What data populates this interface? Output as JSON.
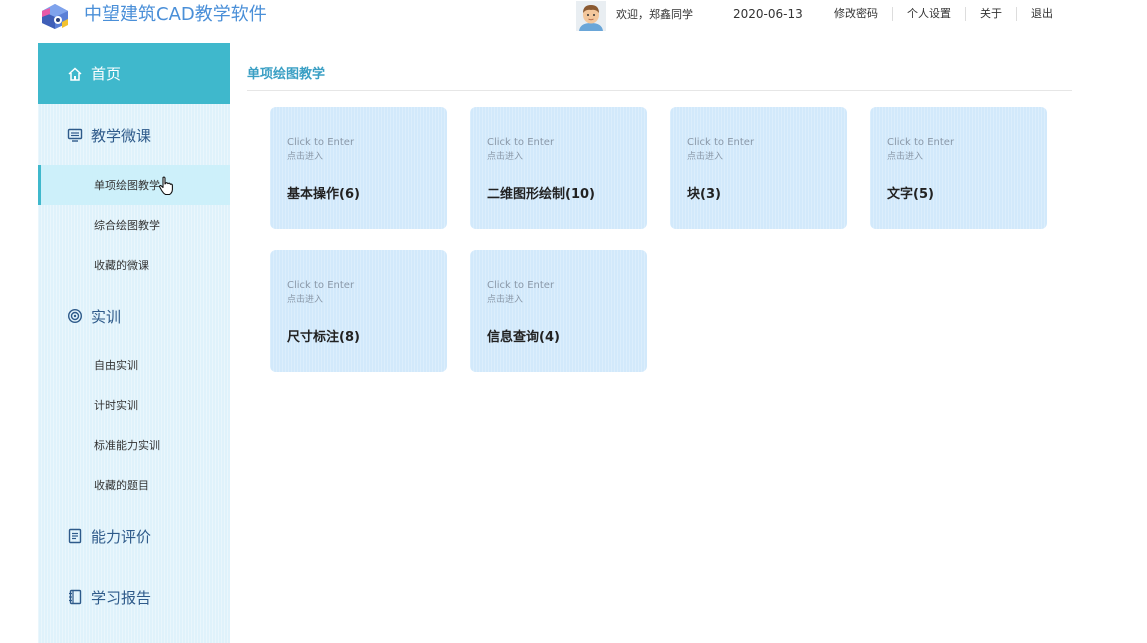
{
  "app": {
    "title": "中望建筑CAD教学软件",
    "logo_icon": "cube-logo-icon",
    "accent_color": "#3fb8cc",
    "title_color": "#4a8fd8"
  },
  "header": {
    "welcome": "欢迎，郑鑫同学",
    "date": "2020-06-13",
    "links": [
      "修改密码",
      "个人设置",
      "关于",
      "退出"
    ]
  },
  "sidebar": {
    "home": {
      "label": "首页",
      "icon": "home-icon"
    },
    "groups": [
      {
        "label": "教学微课",
        "icon": "monitor-icon",
        "items": [
          "单项绘图教学",
          "综合绘图教学",
          "收藏的微课"
        ]
      },
      {
        "label": "实训",
        "icon": "target-icon",
        "items": [
          "自由实训",
          "计时实训",
          "标准能力实训",
          "收藏的题目"
        ]
      },
      {
        "label": "能力评价",
        "icon": "document-icon",
        "items": []
      },
      {
        "label": "学习报告",
        "icon": "notebook-icon",
        "items": []
      }
    ],
    "active_item": "单项绘图教学"
  },
  "main": {
    "section_title": "单项绘图教学",
    "cards": [
      {
        "en": "Click to Enter",
        "cn": "点击进入",
        "title": "基本操作(6)"
      },
      {
        "en": "Click to Enter",
        "cn": "点击进入",
        "title": "二维图形绘制(10)"
      },
      {
        "en": "Click to Enter",
        "cn": "点击进入",
        "title": "块(3)"
      },
      {
        "en": "Click to Enter",
        "cn": "点击进入",
        "title": "文字(5)"
      },
      {
        "en": "Click to Enter",
        "cn": "点击进入",
        "title": "尺寸标注(8)"
      },
      {
        "en": "Click to Enter",
        "cn": "点击进入",
        "title": "信息查询(4)"
      }
    ]
  }
}
